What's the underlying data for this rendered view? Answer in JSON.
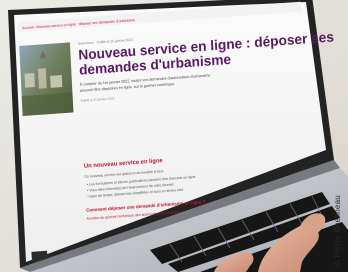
{
  "photo_credit": "© Pierre Bhelineau",
  "screen": {
    "breadcrumb": "Accueil › Nouveau service en ligne : déposer ses demandes d'urbanisme",
    "meta_line": "Urbanisme · Publié le 25 janvier 2022",
    "headline_line1": "Nouveau service en ligne : déposer ses",
    "headline_line2": "demandes d'urbanisme",
    "intro_line1": "À compter du 1er janvier 2022, toutes vos demandes d'autorisation d'urbanisme",
    "intro_line2": "peuvent être déposées en ligne, sur le guichet numérique.",
    "date_small": "Publié le 25 janvier 2022",
    "section_heading": "Un nouveau service en ligne",
    "body_lines": [
      "Ce nouveau service est gratuit et accessible à tous.",
      "• Les formulaires et pièces justificatives peuvent être transmis en ligne.",
      "• Vous êtes informé(e) de l'avancement de votre dossier.",
      "• Gain de temps, démarches simplifiées et suivi en temps réel."
    ],
    "link_text": "Comment déposer une demande d'urbanisme en ligne ?",
    "link_text2": "Accéder au guichet numérique des autorisations d'urbanisme"
  },
  "colors": {
    "accent_red": "#c0162f",
    "headline_purple": "#5b1a64",
    "laptop_silver": "#c9ccd1",
    "key_black": "#161616"
  }
}
